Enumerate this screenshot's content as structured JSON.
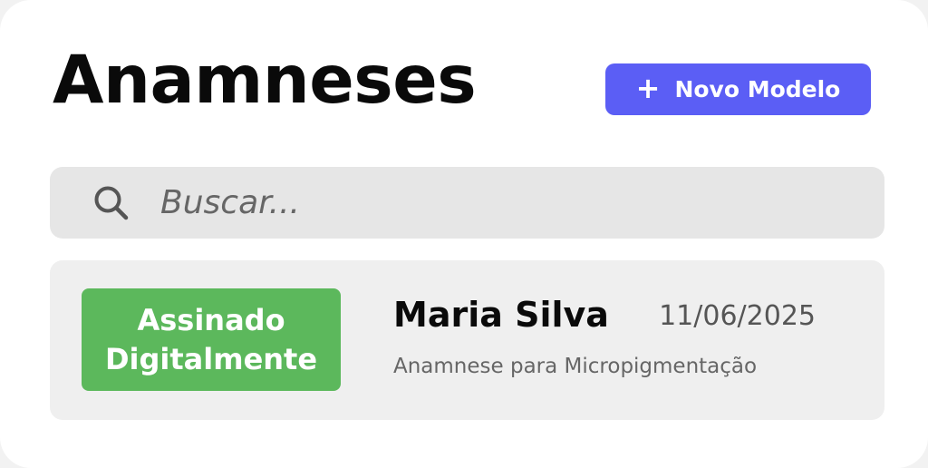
{
  "header": {
    "title": "Anamneses",
    "new_button": {
      "icon": "plus-icon",
      "icon_glyph": "+",
      "label": "Novo Modelo"
    }
  },
  "search": {
    "icon": "search-icon",
    "placeholder": "Buscar..."
  },
  "records": [
    {
      "status_line1": "Assinado",
      "status_line2": "Digitalmente",
      "name": "Maria Silva",
      "date": "11/06/2025",
      "description": "Anamnese para Micropigmentação"
    }
  ],
  "colors": {
    "primary": "#5b5ef5",
    "success": "#5cb85c",
    "surface": "#efefef",
    "search_bg": "#e6e6e6"
  }
}
